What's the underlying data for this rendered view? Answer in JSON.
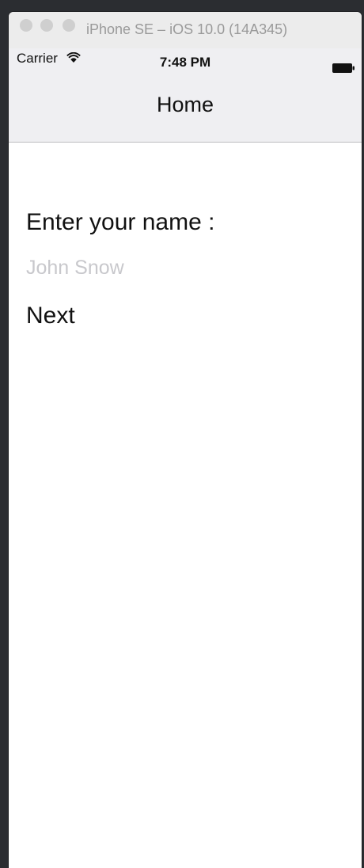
{
  "window": {
    "title": "iPhone SE – iOS 10.0 (14A345)"
  },
  "status_bar": {
    "carrier": "Carrier",
    "time": "7:48 PM",
    "wifi_icon": "wifi-icon",
    "battery_icon": "battery-icon"
  },
  "nav_bar": {
    "title": "Home"
  },
  "form": {
    "label": "Enter your name :",
    "input_value": "",
    "input_placeholder": "John Snow",
    "next_label": "Next"
  },
  "colors": {
    "desktop": "#2b2d31",
    "bar_background": "#efeff2",
    "placeholder": "#c8c8cc",
    "text": "#111111"
  }
}
